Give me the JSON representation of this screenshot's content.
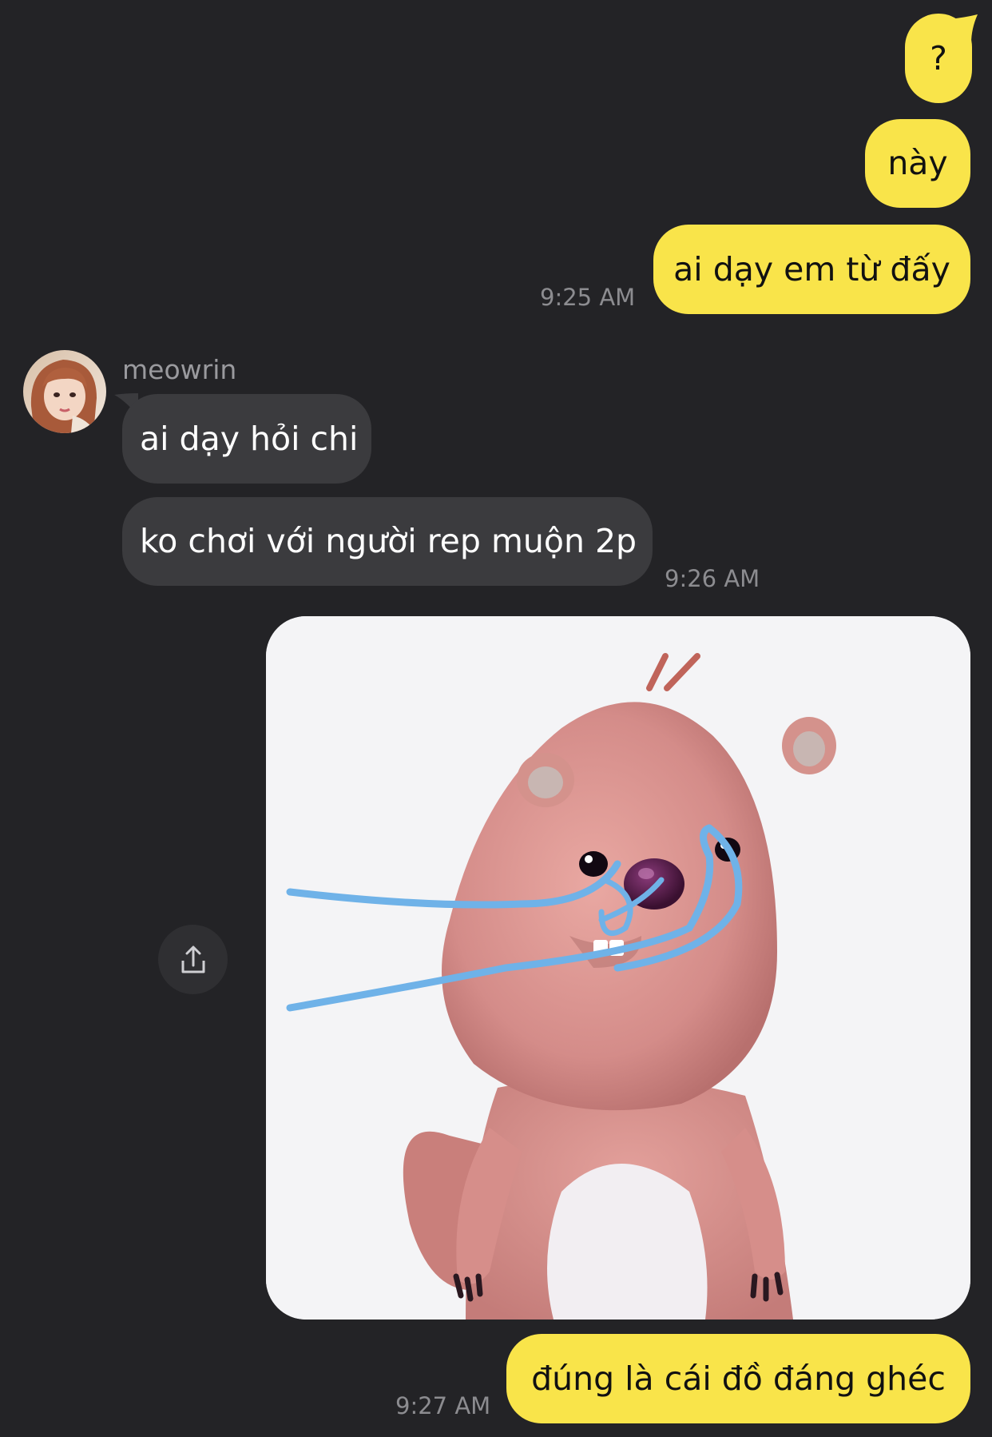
{
  "colors": {
    "background": "#232326",
    "my_bubble": "#f9e44a",
    "their_bubble": "#3b3b3e",
    "timestamp": "#8c8c90"
  },
  "messages": [
    {
      "from": "me",
      "text": "?"
    },
    {
      "from": "me",
      "text": "này"
    },
    {
      "from": "me",
      "text": "ai dạy em từ đấy",
      "time": "9:25 AM"
    },
    {
      "from": "meowrin",
      "sender_name": "meowrin",
      "text": "ai dạy hỏi chi"
    },
    {
      "from": "meowrin",
      "text": "ko chơi với người rep muộn 2p",
      "time": "9:26 AM"
    },
    {
      "from": "me",
      "type": "image",
      "image": "crying-pink-beaver-sticker"
    },
    {
      "from": "me",
      "text": "đúng là cái đồ đáng ghéc",
      "time": "9:27 AM"
    }
  ],
  "icons": {
    "share": "share-icon",
    "avatar": "avatar"
  }
}
